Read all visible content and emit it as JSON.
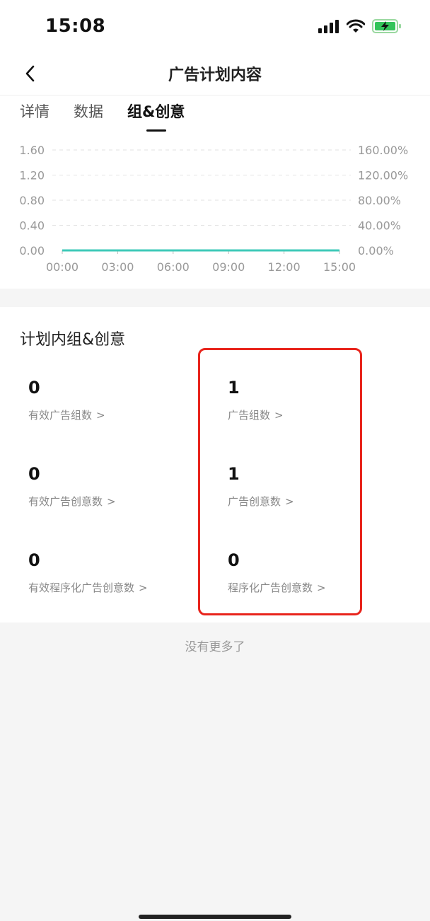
{
  "status_bar": {
    "time": "15:08",
    "signal_icon": "signal-bars-icon",
    "wifi_icon": "wifi-icon",
    "battery_icon": "battery-charging-icon"
  },
  "nav": {
    "back_icon": "chevron-left-icon",
    "title": "广告计划内容"
  },
  "tabs": [
    {
      "label": "详情",
      "active": false
    },
    {
      "label": "数据",
      "active": false
    },
    {
      "label": "组&创意",
      "active": true
    }
  ],
  "chart_data": {
    "type": "line",
    "x_ticks": [
      "00:00",
      "03:00",
      "06:00",
      "09:00",
      "12:00",
      "15:00"
    ],
    "y_left_ticks": [
      "0.00",
      "0.40",
      "0.80",
      "1.20",
      "1.60"
    ],
    "y_right_ticks": [
      "0.00%",
      "40.00%",
      "80.00%",
      "120.00%",
      "160.00%"
    ],
    "ylim_left": [
      0,
      1.6
    ],
    "ylim_right": [
      0,
      160
    ],
    "series": [
      {
        "color": "#3ec9b8",
        "x": [
          "00:00",
          "15:00"
        ],
        "y": [
          0,
          0
        ]
      }
    ],
    "grid": true
  },
  "section": {
    "title": "计划内组&创意",
    "left_stats": [
      {
        "value": "0",
        "label": "有效广告组数",
        "chevron": ">"
      },
      {
        "value": "0",
        "label": "有效广告创意数",
        "chevron": ">"
      },
      {
        "value": "0",
        "label": "有效程序化广告创意数",
        "chevron": ">"
      }
    ],
    "right_stats": [
      {
        "value": "1",
        "label": "广告组数",
        "chevron": ">"
      },
      {
        "value": "1",
        "label": "广告创意数",
        "chevron": ">"
      },
      {
        "value": "0",
        "label": "程序化广告创意数",
        "chevron": ">"
      }
    ],
    "highlight_color": "#e8241c"
  },
  "footer": {
    "no_more": "没有更多了"
  }
}
